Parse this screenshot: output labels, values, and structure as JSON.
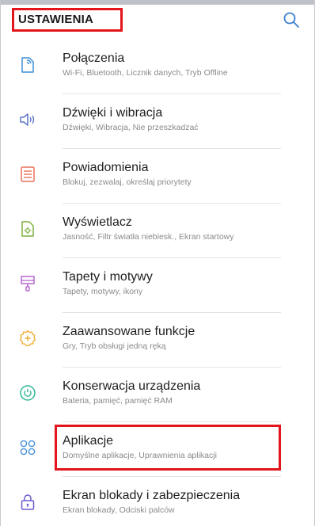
{
  "header": {
    "title": "USTAWIENIA",
    "search_icon": "search-icon"
  },
  "colors": {
    "highlight": "#e3141b",
    "connections": "#3d8fd6",
    "sounds": "#5b76c9",
    "notifications": "#e8705a",
    "display": "#7fb23d",
    "wallpapers": "#b566cf",
    "advanced": "#eda92a",
    "maintenance": "#2fb79a",
    "apps": "#4a90d9",
    "lockscreen": "#6a5ccf"
  },
  "settings": [
    {
      "icon": "connections-icon",
      "label": "Połączenia",
      "desc": "Wi-Fi, Bluetooth, Licznik danych, Tryb Offline"
    },
    {
      "icon": "speaker-icon",
      "label": "Dźwięki i wibracja",
      "desc": "Dźwięki, Wibracja, Nie przeszkadzać"
    },
    {
      "icon": "notifications-icon",
      "label": "Powiadomienia",
      "desc": "Blokuj, zezwalaj, określaj priorytety"
    },
    {
      "icon": "display-icon",
      "label": "Wyświetlacz",
      "desc": "Jasność, Filtr światła niebiesk., Ekran startowy"
    },
    {
      "icon": "paintbrush-icon",
      "label": "Tapety i motywy",
      "desc": "Tapety, motywy, ikony"
    },
    {
      "icon": "advanced-features-icon",
      "label": "Zaawansowane funkcje",
      "desc": "Gry, Tryb obsługi jedną ręką"
    },
    {
      "icon": "device-care-icon",
      "label": "Konserwacja urządzenia",
      "desc": "Bateria, pamięć, pamięć RAM"
    },
    {
      "icon": "apps-icon",
      "label": "Aplikacje",
      "desc": "Domyślne aplikacje, Uprawnienia aplikacji"
    },
    {
      "icon": "lock-icon",
      "label": "Ekran blokady i zabezpieczenia",
      "desc": "Ekran blokady, Odciski palców"
    }
  ]
}
